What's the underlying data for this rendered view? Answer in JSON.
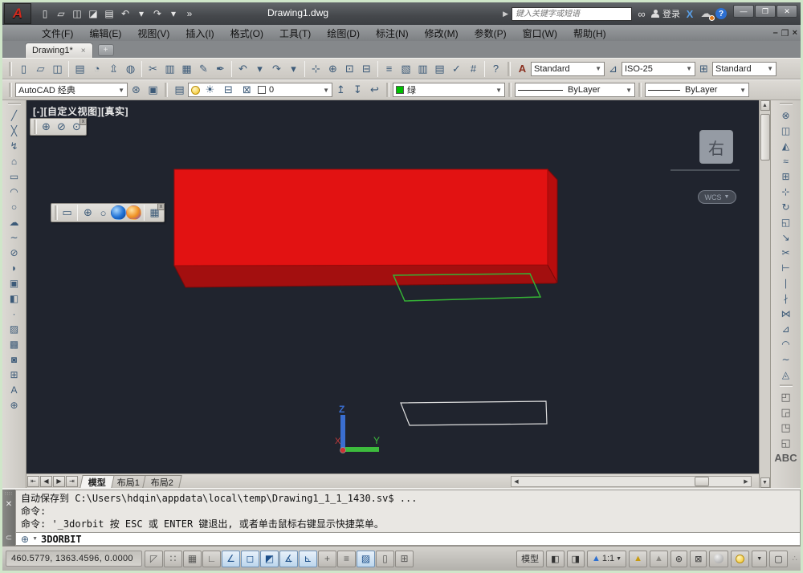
{
  "titlebar": {
    "title": "Drawing1.dwg",
    "logo_letter": "A",
    "search_placeholder": "键入关键字或短语",
    "signin_label": "登录",
    "quick_access": [
      {
        "name": "qnew",
        "glyph": "▯"
      },
      {
        "name": "open",
        "glyph": "▱"
      },
      {
        "name": "save",
        "glyph": "◫"
      },
      {
        "name": "save-as",
        "glyph": "◪"
      },
      {
        "name": "plot",
        "glyph": "▤"
      },
      {
        "name": "undo",
        "glyph": "↶"
      },
      {
        "name": "undo-drop",
        "glyph": "▾"
      },
      {
        "name": "redo",
        "glyph": "↷"
      },
      {
        "name": "redo-drop",
        "glyph": "▾"
      },
      {
        "name": "more",
        "glyph": "»"
      }
    ],
    "window_buttons": {
      "minimize": "—",
      "restore": "❐",
      "close": "✕"
    }
  },
  "menu": {
    "items": [
      "文件(F)",
      "编辑(E)",
      "视图(V)",
      "插入(I)",
      "格式(O)",
      "工具(T)",
      "绘图(D)",
      "标注(N)",
      "修改(M)",
      "参数(P)",
      "窗口(W)",
      "帮助(H)"
    ],
    "doc_buttons": {
      "minimize": "–",
      "restore": "❐",
      "close": "×"
    }
  },
  "tabbar": {
    "doc_tab": "Drawing1*",
    "close": "×",
    "add": "+"
  },
  "toolbar1": {
    "icons": [
      {
        "name": "qnew",
        "glyph": "▯"
      },
      {
        "name": "open",
        "glyph": "▱"
      },
      {
        "name": "qsave",
        "glyph": "◫"
      },
      {
        "name": "sep"
      },
      {
        "name": "plot",
        "glyph": "▤"
      },
      {
        "name": "plot-preview",
        "glyph": "◔"
      },
      {
        "name": "publish",
        "glyph": "⇫"
      },
      {
        "name": "export-dwf",
        "glyph": "◍"
      },
      {
        "name": "sep"
      },
      {
        "name": "cut",
        "glyph": "✂"
      },
      {
        "name": "copy-clip",
        "glyph": "▥"
      },
      {
        "name": "paste",
        "glyph": "▦"
      },
      {
        "name": "match-properties",
        "glyph": "✎"
      },
      {
        "name": "block-editor",
        "glyph": "✒"
      },
      {
        "name": "sep"
      },
      {
        "name": "undo",
        "glyph": "↶"
      },
      {
        "name": "undo-drop",
        "glyph": "▾"
      },
      {
        "name": "redo",
        "glyph": "↷"
      },
      {
        "name": "redo-drop",
        "glyph": "▾"
      },
      {
        "name": "sep"
      },
      {
        "name": "pan",
        "glyph": "⊹"
      },
      {
        "name": "zoom-realtime",
        "glyph": "⊕"
      },
      {
        "name": "zoom-window",
        "glyph": "⊡"
      },
      {
        "name": "zoom-previous",
        "glyph": "⊟"
      },
      {
        "name": "sep"
      },
      {
        "name": "properties",
        "glyph": "≡"
      },
      {
        "name": "designcenter",
        "glyph": "▧"
      },
      {
        "name": "tool-palettes",
        "glyph": "▥"
      },
      {
        "name": "sheetset-manager",
        "glyph": "▤"
      },
      {
        "name": "markup",
        "glyph": "✓"
      },
      {
        "name": "quickcalc",
        "glyph": "#"
      },
      {
        "name": "sep"
      },
      {
        "name": "help",
        "glyph": "?"
      }
    ],
    "text_style": "Standard",
    "dim_style": "ISO-25",
    "table_style": "Standard"
  },
  "toolbar2": {
    "workspace": "AutoCAD 经典",
    "workspace_icons": [
      {
        "name": "workspace-settings",
        "glyph": "⊛"
      },
      {
        "name": "capture",
        "glyph": "▣"
      }
    ],
    "layer_mgr_icons": [
      {
        "name": "layer-properties",
        "glyph": "▤"
      }
    ],
    "layer_state": [
      {
        "name": "layer-on",
        "glyph": "",
        "cls": "bulb"
      },
      {
        "name": "layer-freeze",
        "glyph": "☀"
      },
      {
        "name": "layer-plot",
        "glyph": "⊟"
      },
      {
        "name": "layer-lock",
        "glyph": "⊠"
      }
    ],
    "layer_name": "0",
    "layer_tools": [
      {
        "name": "make-object-layer-current",
        "glyph": "↥"
      },
      {
        "name": "layer-match",
        "glyph": "↧"
      },
      {
        "name": "layer-previous",
        "glyph": "↩"
      }
    ],
    "color_name": "绿",
    "color_hex": "#00c000",
    "linetype": "ByLayer",
    "lineweight": "ByLayer"
  },
  "canvas": {
    "viewport_label": "[-][自定义视图][真实]",
    "viewcube_face": "右",
    "wcs_label": "WCS",
    "orbit_toolbar": [
      {
        "name": "constrained-orbit",
        "glyph": "⊕"
      },
      {
        "name": "free-orbit",
        "glyph": "⊘"
      },
      {
        "name": "continuous-orbit",
        "glyph": "⊙"
      }
    ],
    "visual_styles_toolbar": [
      {
        "name": "2d-wireframe",
        "glyph": "▭"
      },
      {
        "name": "sep"
      },
      {
        "name": "3d-wireframe",
        "glyph": "⊕"
      },
      {
        "name": "3d-hidden",
        "glyph": "○"
      },
      {
        "name": "realistic",
        "glyph": "",
        "cls": "sphere blue"
      },
      {
        "name": "conceptual",
        "glyph": "",
        "cls": "sphere orange"
      },
      {
        "name": "sep"
      },
      {
        "name": "manage-visual-styles",
        "glyph": "▦"
      }
    ],
    "ucs": {
      "x_label": "X",
      "y_label": "Y",
      "z_label": "Z"
    }
  },
  "draw_toolbar": {
    "icons": [
      {
        "name": "line",
        "glyph": "╱"
      },
      {
        "name": "construction-line",
        "glyph": "╳"
      },
      {
        "name": "polyline",
        "glyph": "↯"
      },
      {
        "name": "polygon",
        "glyph": "⌂"
      },
      {
        "name": "rectangle",
        "glyph": "▭"
      },
      {
        "name": "arc",
        "glyph": "◠"
      },
      {
        "name": "circle",
        "glyph": "○"
      },
      {
        "name": "revision-cloud",
        "glyph": "☁"
      },
      {
        "name": "spline",
        "glyph": "∼"
      },
      {
        "name": "ellipse",
        "glyph": "⊘"
      },
      {
        "name": "ellipse-arc",
        "glyph": "◗"
      },
      {
        "name": "insert-block",
        "glyph": "▣"
      },
      {
        "name": "make-block",
        "glyph": "◧"
      },
      {
        "name": "point",
        "glyph": "·"
      },
      {
        "name": "hatch",
        "glyph": "▨"
      },
      {
        "name": "gradient",
        "glyph": "▩"
      },
      {
        "name": "region",
        "glyph": "◙"
      },
      {
        "name": "table",
        "glyph": "⊞"
      },
      {
        "name": "multiline-text",
        "glyph": "A"
      },
      {
        "name": "add-selected",
        "glyph": "⊕"
      }
    ]
  },
  "modify_toolbar": {
    "icons": [
      {
        "name": "erase",
        "glyph": "⊗"
      },
      {
        "name": "copy",
        "glyph": "◫"
      },
      {
        "name": "mirror",
        "glyph": "◭"
      },
      {
        "name": "offset",
        "glyph": "≈"
      },
      {
        "name": "array",
        "glyph": "⊞"
      },
      {
        "name": "move",
        "glyph": "⊹"
      },
      {
        "name": "rotate",
        "glyph": "↻"
      },
      {
        "name": "scale",
        "glyph": "◱"
      },
      {
        "name": "stretch",
        "glyph": "↘"
      },
      {
        "name": "trim",
        "glyph": "✂"
      },
      {
        "name": "extend",
        "glyph": "⊢"
      },
      {
        "name": "break-at-point",
        "glyph": "∣"
      },
      {
        "name": "break",
        "glyph": "∤"
      },
      {
        "name": "join",
        "glyph": "⋈"
      },
      {
        "name": "chamfer",
        "glyph": "⊿"
      },
      {
        "name": "fillet",
        "glyph": "◠"
      },
      {
        "name": "blend-curves",
        "glyph": "∼"
      },
      {
        "name": "explode",
        "glyph": "◬"
      }
    ]
  },
  "draworder_toolbar": {
    "icons": [
      {
        "name": "bring-to-front",
        "glyph": "◰"
      },
      {
        "name": "send-to-back",
        "glyph": "◲"
      },
      {
        "name": "bring-above-objects",
        "glyph": "◳"
      },
      {
        "name": "send-under-objects",
        "glyph": "◱"
      },
      {
        "name": "text-to-front",
        "glyph": "ABC",
        "cls": "abc"
      }
    ]
  },
  "layout_tabs": [
    {
      "label": "模型",
      "active": true
    },
    {
      "label": "布局1",
      "active": false
    },
    {
      "label": "布局2",
      "active": false
    }
  ],
  "command": {
    "lines": [
      "自动保存到 C:\\Users\\hdqin\\appdata\\local\\temp\\Drawing1_1_1_1430.sv$ ...",
      "命令:",
      "命令: '_3dorbit 按 ESC 或 ENTER 键退出, 或者单击鼠标右键显示快捷菜单。"
    ],
    "prompt": "3DORBIT"
  },
  "status": {
    "coords": "460.5779,  1363.4596,  0.0000",
    "toggles": [
      {
        "name": "infer-constraints",
        "glyph": "◸",
        "on": false
      },
      {
        "name": "snap-mode",
        "glyph": "∷",
        "on": false
      },
      {
        "name": "grid-display",
        "glyph": "▦",
        "on": false
      },
      {
        "name": "ortho-mode",
        "glyph": "∟",
        "on": false
      },
      {
        "name": "polar-tracking",
        "glyph": "∠",
        "on": true
      },
      {
        "name": "object-snap",
        "glyph": "◻",
        "on": true
      },
      {
        "name": "object-snap-3d",
        "glyph": "◩",
        "on": true
      },
      {
        "name": "object-snap-tracking",
        "glyph": "∡",
        "on": true
      },
      {
        "name": "dynamic-ucs",
        "glyph": "⊾",
        "on": true
      },
      {
        "name": "dynamic-input",
        "glyph": "+",
        "on": false
      },
      {
        "name": "lineweight-display",
        "glyph": "≡",
        "on": false
      },
      {
        "name": "transparency-display",
        "glyph": "▨",
        "on": true
      },
      {
        "name": "quick-properties",
        "glyph": "▯",
        "on": false
      },
      {
        "name": "selection-cycling",
        "glyph": "⊞",
        "on": false
      }
    ],
    "model_button": "模型",
    "annotation_scale": "1:1"
  },
  "colors": {
    "canvas_bg": "#20242e",
    "box_front": "#e21212",
    "box_side": "#b80d0d",
    "box_bottom": "#a30f0f",
    "box_edge": "#8a0808",
    "green_outline": "#35b335",
    "white_outline": "#e0e0e0",
    "ucs_z": "#3a6ed0",
    "ucs_y": "#3dbb3d",
    "ucs_x": "#c43c3c"
  }
}
